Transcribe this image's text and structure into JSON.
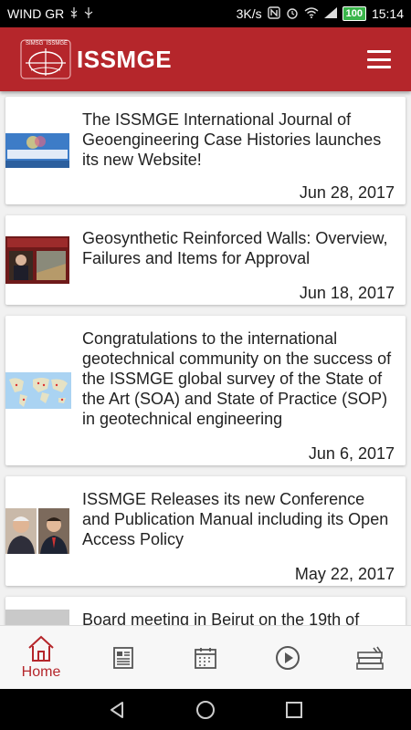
{
  "status_bar": {
    "carrier": "WIND GR",
    "network_speed": "3K/s",
    "battery": "100",
    "time": "15:14"
  },
  "header": {
    "logo_small_left": "SIMSG",
    "logo_small_right": "ISSMGE",
    "title": "ISSMGE",
    "menu_icon": "hamburger-menu-icon"
  },
  "feed": {
    "items": [
      {
        "title": "The ISSMGE International Journal of Geoengineering Case Histories launches its new Website!",
        "date": "Jun 28, 2017",
        "thumbnail": "journal-website-thumbnail"
      },
      {
        "title": "Geosynthetic Reinforced Walls: Overview, Failures and Items for Approval",
        "date": "Jun 18, 2017",
        "thumbnail": "walls-lecture-thumbnail"
      },
      {
        "title": "Congratulations to the international geotechnical community on the success of the ISSMGE global survey of the State of the Art (SOA) and State of Practice (SOP) in geotechnical engineering",
        "date": "Jun 6, 2017",
        "thumbnail": "world-map-thumbnail"
      },
      {
        "title": "ISSMGE Releases its new Conference and Publication Manual including its Open Access Policy",
        "date": "May 22, 2017",
        "thumbnail": "people-portraits-thumbnail"
      },
      {
        "title": "Board meeting in Beirut on the 19th of",
        "date": "",
        "thumbnail": "board-meeting-thumbnail"
      }
    ]
  },
  "bottom_nav": {
    "items": [
      {
        "label": "Home",
        "icon": "home-icon",
        "active": true
      },
      {
        "label": "",
        "icon": "news-icon",
        "active": false
      },
      {
        "label": "",
        "icon": "calendar-icon",
        "active": false
      },
      {
        "label": "",
        "icon": "play-icon",
        "active": false
      },
      {
        "label": "",
        "icon": "books-icon",
        "active": false
      }
    ]
  },
  "colors": {
    "brand": "#b5262b",
    "feed_background": "#f1f1f1",
    "card_background": "#ffffff"
  }
}
